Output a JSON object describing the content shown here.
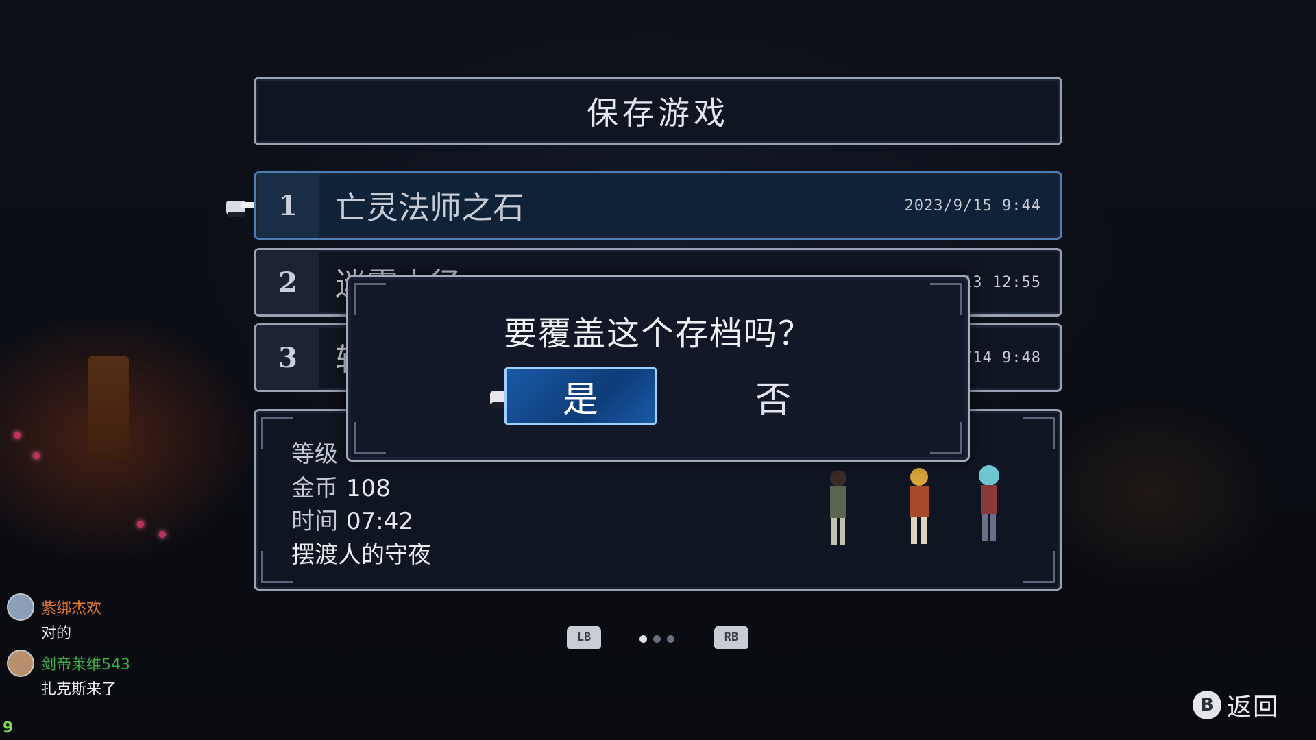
{
  "screen_title": "保存游戏",
  "slots": [
    {
      "number": "1",
      "name": "亡灵法师之石",
      "timestamp": "2023/9/15 9:44"
    },
    {
      "number": "2",
      "name": "迷雾小径",
      "timestamp": "13 12:55"
    },
    {
      "number": "3",
      "name": "斩",
      "timestamp": "/14 9:48"
    }
  ],
  "details": {
    "level_label": "等级",
    "gold_label": "金币",
    "gold_value": "108",
    "time_label": "时间",
    "time_value": "07:42",
    "location": "摆渡人的守夜"
  },
  "dialog": {
    "question": "要覆盖这个存档吗？",
    "yes_label": "是",
    "no_label": "否"
  },
  "pager": {
    "prev_label": "LB",
    "next_label": "RB",
    "pages": 3,
    "current": 1
  },
  "back": {
    "button_glyph": "B",
    "label": "返回"
  },
  "chat": [
    {
      "user": "紫绑杰欢",
      "message": "对的",
      "name_color": "#e2792b"
    },
    {
      "user": "剑帝莱维543",
      "message": "扎克斯来了",
      "name_color": "#3bb04a"
    }
  ],
  "corner_counter": "9"
}
